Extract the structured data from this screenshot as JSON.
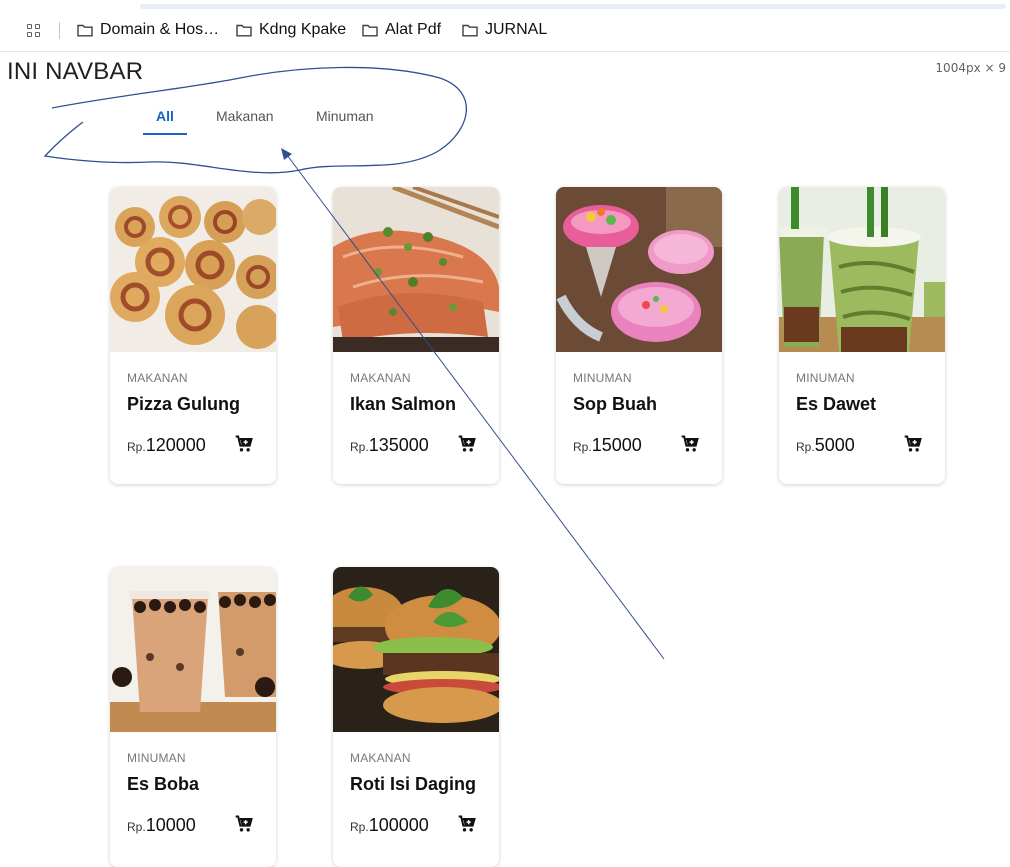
{
  "bookmarks": [
    {
      "label": "Domain & Hos…",
      "icon": "folder-icon"
    },
    {
      "label": "Kdng Kpake",
      "icon": "folder-icon"
    },
    {
      "label": "Alat Pdf",
      "icon": "folder-icon"
    },
    {
      "label": "JURNAL",
      "icon": "folder-icon"
    }
  ],
  "page_title": "INI NAVBAR",
  "dims_label": "1004px × 9",
  "tabs": [
    {
      "label": "All",
      "active": true
    },
    {
      "label": "Makanan",
      "active": false
    },
    {
      "label": "Minuman",
      "active": false
    }
  ],
  "accent_color": "#1565c0",
  "products": [
    {
      "category": "MAKANAN",
      "name": "Pizza Gulung",
      "currency": "Rp.",
      "price": "120000"
    },
    {
      "category": "MAKANAN",
      "name": "Ikan Salmon",
      "currency": "Rp.",
      "price": "135000"
    },
    {
      "category": "MINUMAN",
      "name": "Sop Buah",
      "currency": "Rp.",
      "price": "15000"
    },
    {
      "category": "MINUMAN",
      "name": "Es Dawet",
      "currency": "Rp.",
      "price": "5000"
    },
    {
      "category": "MINUMAN",
      "name": "Es Boba",
      "currency": "Rp.",
      "price": "10000"
    },
    {
      "category": "MAKANAN",
      "name": "Roti Isi Daging",
      "currency": "Rp.",
      "price": "100000"
    }
  ]
}
